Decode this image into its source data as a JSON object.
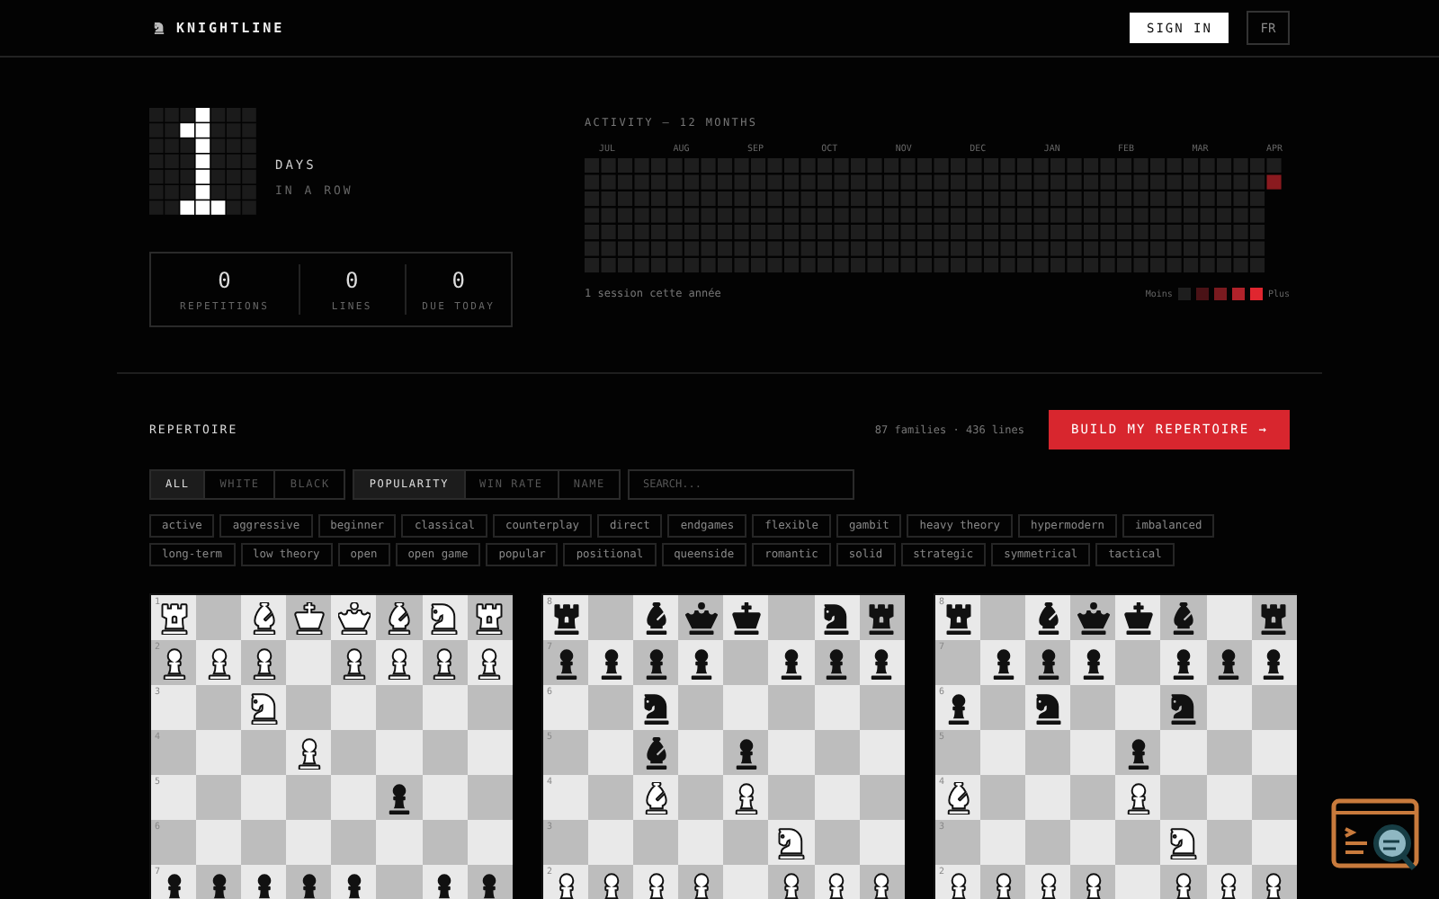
{
  "header": {
    "brand": "KNIGHTLINE",
    "sign_in": "SIGN IN",
    "language": "FR"
  },
  "streak": {
    "unit": "DAYS",
    "caption": "IN A ROW"
  },
  "stats": [
    {
      "value": "0",
      "label": "REPETITIONS"
    },
    {
      "value": "0",
      "label": "LINES"
    },
    {
      "value": "0",
      "label": "DUE TODAY"
    }
  ],
  "activity": {
    "title": "ACTIVITY — 12 MONTHS",
    "months": [
      "JUL",
      "AUG",
      "SEP",
      "OCT",
      "NOV",
      "DEC",
      "JAN",
      "FEB",
      "MAR",
      "APR"
    ],
    "summary": "1 session cette année",
    "legend_less": "Moins",
    "legend_more": "Plus"
  },
  "repertoire": {
    "title": "REPERTOIRE",
    "counts": "87 families · 436 lines",
    "build_button": "BUILD MY REPERTOIRE →"
  },
  "color_filters": [
    {
      "label": "ALL",
      "selected": true
    },
    {
      "label": "WHITE",
      "selected": false
    },
    {
      "label": "BLACK",
      "selected": false
    }
  ],
  "sort_options": [
    {
      "label": "POPULARITY",
      "selected": true
    },
    {
      "label": "WIN RATE",
      "selected": false
    },
    {
      "label": "NAME",
      "selected": false
    }
  ],
  "search": {
    "placeholder": "SEARCH..."
  },
  "tags": [
    "active",
    "aggressive",
    "beginner",
    "classical",
    "counterplay",
    "direct",
    "endgames",
    "flexible",
    "gambit",
    "heavy theory",
    "hypermodern",
    "imbalanced",
    "long-term",
    "low theory",
    "open",
    "open game",
    "popular",
    "positional",
    "queenside",
    "romantic",
    "solid",
    "strategic",
    "symmetrical",
    "tactical"
  ],
  "boards": [
    {
      "ranks": [
        "1",
        "2",
        "3",
        "4",
        "5",
        "6",
        "7"
      ],
      "rows": [
        [
          {
            "kind": "rook",
            "white": true
          },
          null,
          {
            "kind": "bishop",
            "white": true
          },
          {
            "kind": "king",
            "white": true
          },
          {
            "kind": "queen",
            "white": true
          },
          {
            "kind": "bishop",
            "white": true
          },
          {
            "kind": "knight",
            "white": true
          },
          {
            "kind": "rook",
            "white": true
          }
        ],
        [
          {
            "kind": "pawn",
            "white": true
          },
          {
            "kind": "pawn",
            "white": true
          },
          {
            "kind": "pawn",
            "white": true
          },
          null,
          {
            "kind": "pawn",
            "white": true
          },
          {
            "kind": "pawn",
            "white": true
          },
          {
            "kind": "pawn",
            "white": true
          },
          {
            "kind": "pawn",
            "white": true
          }
        ],
        [
          null,
          null,
          {
            "kind": "knight",
            "white": true
          },
          null,
          null,
          null,
          null,
          null
        ],
        [
          null,
          null,
          null,
          {
            "kind": "pawn",
            "white": true
          },
          null,
          null,
          null,
          null
        ],
        [
          null,
          null,
          null,
          null,
          null,
          {
            "kind": "pawn",
            "white": false
          },
          null,
          null
        ],
        [
          null,
          null,
          null,
          null,
          null,
          null,
          null,
          null
        ],
        [
          {
            "kind": "pawn",
            "white": false
          },
          {
            "kind": "pawn",
            "white": false
          },
          {
            "kind": "pawn",
            "white": false
          },
          {
            "kind": "pawn",
            "white": false
          },
          {
            "kind": "pawn",
            "white": false
          },
          null,
          {
            "kind": "pawn",
            "white": false
          },
          {
            "kind": "pawn",
            "white": false
          }
        ]
      ]
    },
    {
      "ranks": [
        "8",
        "7",
        "6",
        "5",
        "4",
        "3",
        "2"
      ],
      "rows": [
        [
          {
            "kind": "rook",
            "white": false
          },
          null,
          {
            "kind": "bishop",
            "white": false
          },
          {
            "kind": "queen",
            "white": false
          },
          {
            "kind": "king",
            "white": false
          },
          null,
          {
            "kind": "knight",
            "white": false
          },
          {
            "kind": "rook",
            "white": false
          }
        ],
        [
          {
            "kind": "pawn",
            "white": false
          },
          {
            "kind": "pawn",
            "white": false
          },
          {
            "kind": "pawn",
            "white": false
          },
          {
            "kind": "pawn",
            "white": false
          },
          null,
          {
            "kind": "pawn",
            "white": false
          },
          {
            "kind": "pawn",
            "white": false
          },
          {
            "kind": "pawn",
            "white": false
          }
        ],
        [
          null,
          null,
          {
            "kind": "knight",
            "white": false
          },
          null,
          null,
          null,
          null,
          null
        ],
        [
          null,
          null,
          {
            "kind": "bishop",
            "white": false
          },
          null,
          {
            "kind": "pawn",
            "white": false
          },
          null,
          null,
          null
        ],
        [
          null,
          null,
          {
            "kind": "bishop",
            "white": true
          },
          null,
          {
            "kind": "pawn",
            "white": true
          },
          null,
          null,
          null
        ],
        [
          null,
          null,
          null,
          null,
          null,
          {
            "kind": "knight",
            "white": true
          },
          null,
          null
        ],
        [
          {
            "kind": "pawn",
            "white": true
          },
          {
            "kind": "pawn",
            "white": true
          },
          {
            "kind": "pawn",
            "white": true
          },
          {
            "kind": "pawn",
            "white": true
          },
          null,
          {
            "kind": "pawn",
            "white": true
          },
          {
            "kind": "pawn",
            "white": true
          },
          {
            "kind": "pawn",
            "white": true
          }
        ]
      ]
    },
    {
      "ranks": [
        "8",
        "7",
        "6",
        "5",
        "4",
        "3",
        "2"
      ],
      "rows": [
        [
          {
            "kind": "rook",
            "white": false
          },
          null,
          {
            "kind": "bishop",
            "white": false
          },
          {
            "kind": "queen",
            "white": false
          },
          {
            "kind": "king",
            "white": false
          },
          {
            "kind": "bishop",
            "white": false
          },
          null,
          {
            "kind": "rook",
            "white": false
          }
        ],
        [
          null,
          {
            "kind": "pawn",
            "white": false
          },
          {
            "kind": "pawn",
            "white": false
          },
          {
            "kind": "pawn",
            "white": false
          },
          null,
          {
            "kind": "pawn",
            "white": false
          },
          {
            "kind": "pawn",
            "white": false
          },
          {
            "kind": "pawn",
            "white": false
          }
        ],
        [
          {
            "kind": "pawn",
            "white": false
          },
          null,
          {
            "kind": "knight",
            "white": false
          },
          null,
          null,
          {
            "kind": "knight",
            "white": false
          },
          null,
          null
        ],
        [
          null,
          null,
          null,
          null,
          {
            "kind": "pawn",
            "white": false
          },
          null,
          null,
          null
        ],
        [
          {
            "kind": "bishop",
            "white": true
          },
          null,
          null,
          null,
          {
            "kind": "pawn",
            "white": true
          },
          null,
          null,
          null
        ],
        [
          null,
          null,
          null,
          null,
          null,
          {
            "kind": "knight",
            "white": true
          },
          null,
          null
        ],
        [
          {
            "kind": "pawn",
            "white": true
          },
          {
            "kind": "pawn",
            "white": true
          },
          {
            "kind": "pawn",
            "white": true
          },
          {
            "kind": "pawn",
            "white": true
          },
          null,
          {
            "kind": "pawn",
            "white": true
          },
          {
            "kind": "pawn",
            "white": true
          },
          {
            "kind": "pawn",
            "white": true
          }
        ]
      ]
    }
  ]
}
